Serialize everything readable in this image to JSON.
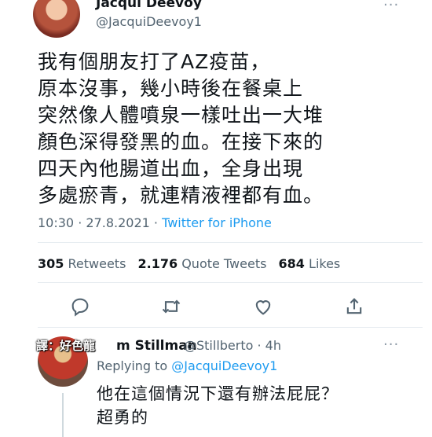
{
  "tweet": {
    "author_name": "Jacqui Deevoy",
    "author_handle": "@JacquiDeevoy1",
    "text": "我有個朋友打了AZ疫苗，\n原本沒事，幾小時後在餐桌上\n突然像人體噴泉一樣吐出一大堆\n顏色深得發黑的血。在接下來的\n四天內他腸道出血，全身出現\n多處瘀青，就連精液裡都有血。",
    "time": "10:30 · 27.8.2021 · ",
    "app": "Twitter for iPhone",
    "more_icon": "···"
  },
  "stats": {
    "retweets_count": "305",
    "retweets_label": "Retweets",
    "quotes_count": "2.176",
    "quotes_label": "Quote Tweets",
    "likes_count": "684",
    "likes_label": "Likes"
  },
  "actions": [
    "reply-icon",
    "retweet-icon",
    "like-icon",
    "share-icon"
  ],
  "reply": {
    "author_name": "m Stillman",
    "author_handle": "@Stillberto · 4h",
    "replying_prefix": "Replying to ",
    "replying_to": "@JacquiDeevoy1",
    "text": "他在這個情況下還有辦法屁屁？\n超勇的",
    "watermark": "譯：好色龍",
    "more_icon": "···"
  },
  "colors": {
    "accent": "#1d9bf0",
    "secondary_text": "#536471",
    "divider": "#e6ecf0"
  }
}
